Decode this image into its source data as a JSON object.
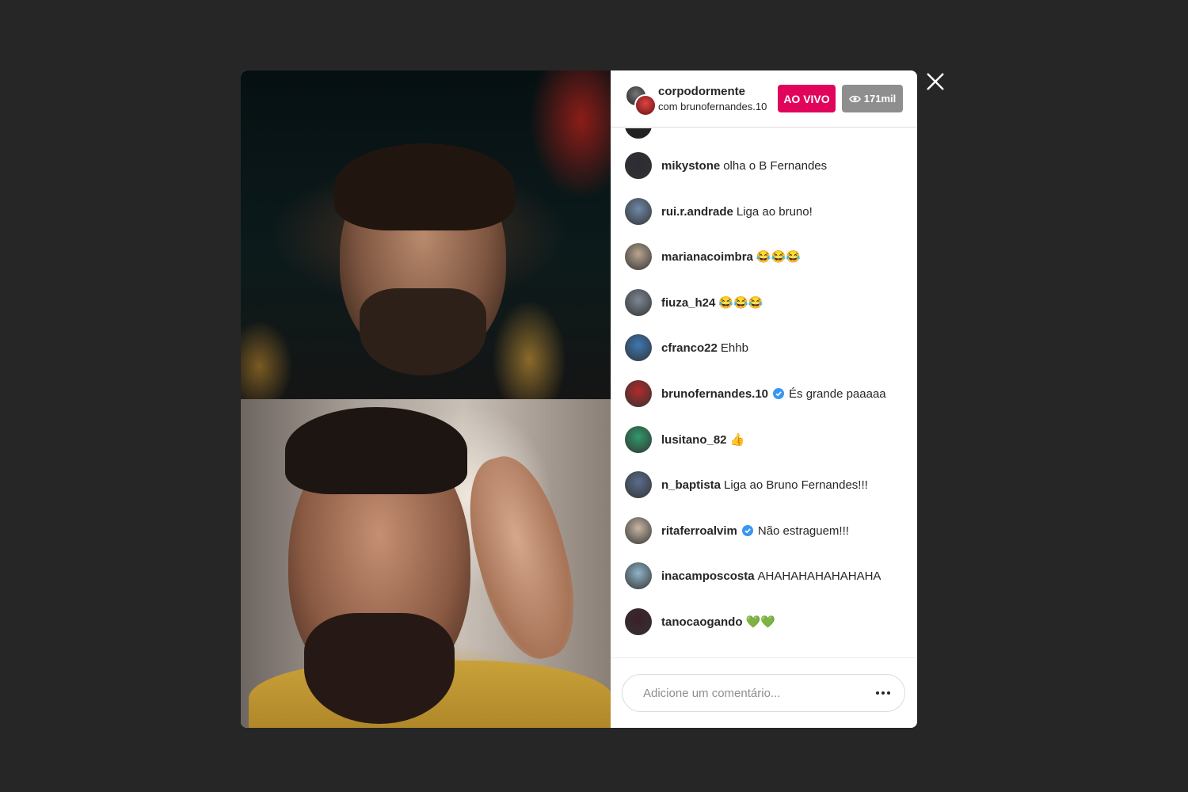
{
  "modal": {
    "close_icon": "close-icon"
  },
  "header": {
    "host_username": "corpodormente",
    "with_text": "com brunofernandes.10",
    "live_label": "AO VIVO",
    "viewers_icon": "eye-icon",
    "viewers_count": "171mil"
  },
  "colors": {
    "live_badge": "#e1045b",
    "viewers_badge": "#8e8e8e",
    "verified": "#3897f0",
    "background": "#262626"
  },
  "comments": [
    {
      "user": "mikystone",
      "text": "olha o B Fernandes",
      "verified": false,
      "avatar_color": "#2b2b33"
    },
    {
      "user": "rui.r.andrade",
      "text": "Liga ao bruno!",
      "verified": false,
      "avatar_color": "#6f89a8"
    },
    {
      "user": "marianacoimbra",
      "text": "😂😂😂",
      "verified": false,
      "avatar_color": "#b9a590"
    },
    {
      "user": "fiuza_h24",
      "text": "😂😂😂",
      "verified": false,
      "avatar_color": "#7d8793"
    },
    {
      "user": "cfranco22",
      "text": "Ehhb",
      "verified": false,
      "avatar_color": "#3d78b5"
    },
    {
      "user": "brunofernandes.10",
      "text": "És grande paaaaa",
      "verified": true,
      "avatar_color": "#b32a2a"
    },
    {
      "user": "lusitano_82",
      "text": "👍",
      "verified": false,
      "avatar_color": "#2f9a6a"
    },
    {
      "user": "n_baptista",
      "text": "Liga ao Bruno Fernandes!!!",
      "verified": false,
      "avatar_color": "#5a6d8c"
    },
    {
      "user": "ritaferroalvim",
      "text": "Não estraguem!!!",
      "verified": true,
      "avatar_color": "#c9b7a6"
    },
    {
      "user": "inacamposcosta",
      "text": "AHAHAHAHAHAHAHA",
      "verified": false,
      "avatar_color": "#8fb4c8"
    },
    {
      "user": "tanocaogando",
      "text": "💚💚",
      "verified": false,
      "avatar_color": "#3b1f2a"
    }
  ],
  "footer": {
    "comment_placeholder": "Adicione um comentário...",
    "more_icon": "more-options-icon"
  }
}
